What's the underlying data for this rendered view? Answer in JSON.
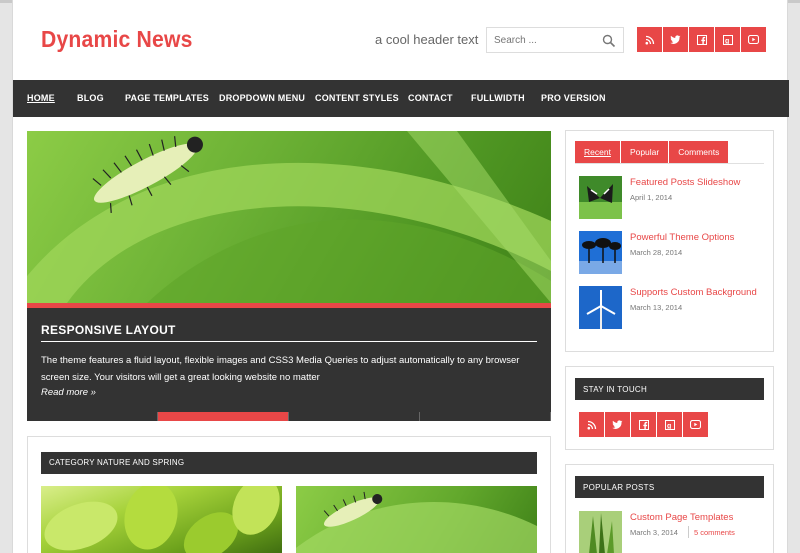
{
  "header": {
    "logo": "Dynamic News",
    "tagline": "a cool header text",
    "search_placeholder": "Search ...",
    "social_icons": [
      "rss-icon",
      "twitter-icon",
      "facebook-icon",
      "googleplus-icon",
      "youtube-icon"
    ]
  },
  "nav": {
    "items": [
      "HOME",
      "BLOG",
      "PAGE TEMPLATES",
      "DROPDOWN MENU",
      "CONTENT STYLES",
      "CONTACT",
      "FULLWIDTH",
      "PRO VERSION"
    ],
    "active": "HOME"
  },
  "slider": {
    "title": "RESPONSIVE LAYOUT",
    "text": "The theme features a fluid layout, flexible images and CSS3 Media Queries to adjust automatically to any browser screen size. Your visitors will get a great looking website no matter",
    "read_more": "Read more »",
    "slide_count": 4,
    "active_slide": 2
  },
  "category": {
    "title": "CATEGORY NATURE AND SPRING"
  },
  "sidebar": {
    "tabs": [
      "Recent",
      "Popular",
      "Comments"
    ],
    "active_tab": "Recent",
    "recent_posts": [
      {
        "title": "Featured Posts Slideshow",
        "date": "April 1, 2014"
      },
      {
        "title": "Powerful Theme Options",
        "date": "March 28, 2014"
      },
      {
        "title": "Supports Custom Background",
        "date": "March 13, 2014"
      }
    ],
    "stay_in_touch": "STAY IN TOUCH",
    "popular_title": "POPULAR POSTS",
    "popular_posts": [
      {
        "title": "Custom Page Templates",
        "date": "March 3, 2014",
        "comments": "5 comments"
      }
    ]
  },
  "colors": {
    "accent": "#e84747",
    "dark": "#333333"
  }
}
